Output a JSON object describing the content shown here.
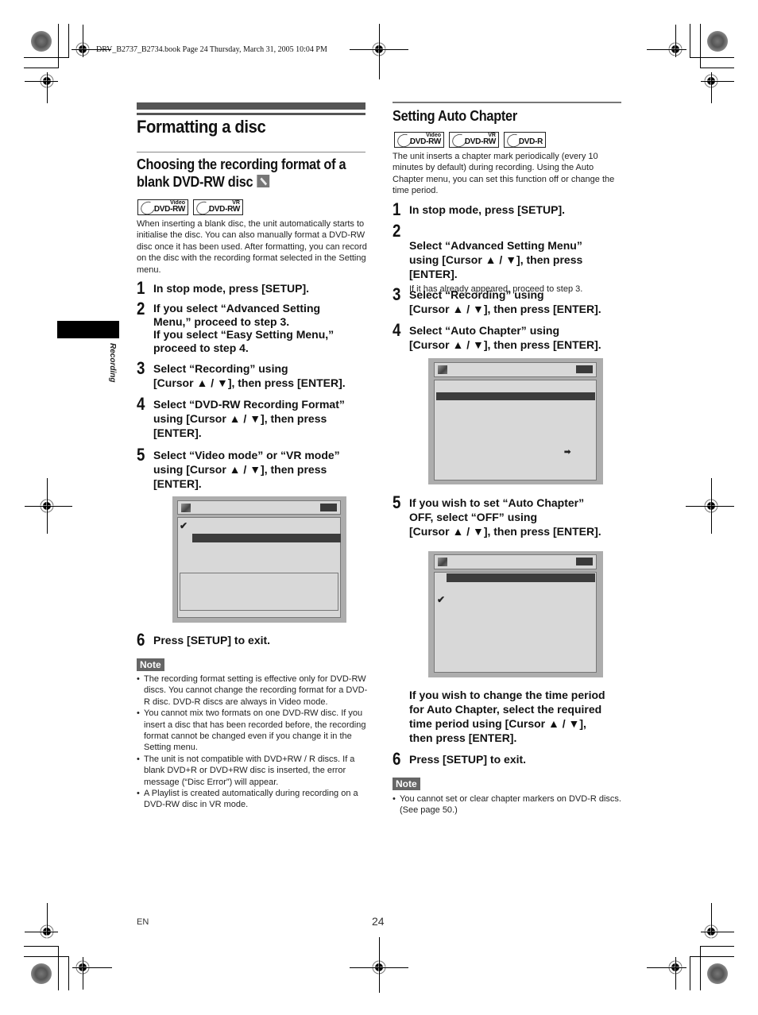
{
  "print_header": "DRV_B2737_B2734.book  Page 24  Thursday, March 31, 2005  10:04 PM",
  "side_tab": {
    "label": "Recording"
  },
  "left": {
    "page_title": "Formatting a disc",
    "section_title": "Choosing the recording format of a blank DVD-RW disc",
    "section_icon": "wrench-icon",
    "badges": [
      {
        "top": "Video",
        "main": "DVD-RW"
      },
      {
        "top": "VR",
        "main": "DVD-RW"
      }
    ],
    "intro": "When inserting a blank disc, the unit automatically starts to initialise the disc. You can also manually format a DVD-RW disc once it has been used. After formatting, you can record on the disc with the recording format selected in the Setting menu.",
    "steps": [
      {
        "num": "1",
        "text": "In stop mode, press [SETUP]."
      },
      {
        "num": "2",
        "text": "If you select “Advanced Setting\nMenu,” proceed to step 3.\nIf you select “Easy Setting Menu,”\nproceed to step 4."
      },
      {
        "num": "3",
        "text": "Select “Recording” using\n[Cursor ▲ / ▼], then press [ENTER]."
      },
      {
        "num": "4",
        "text": "Select “DVD-RW Recording Format”\nusing [Cursor ▲ / ▼], then press\n[ENTER]."
      },
      {
        "num": "5",
        "text": "Select “Video mode” or “VR mode”\nusing [Cursor ▲ / ▼], then press\n[ENTER]."
      },
      {
        "num": "6",
        "text": "Press [SETUP] to exit."
      }
    ],
    "note_label": "Note",
    "notes": [
      "The recording format setting is effective only for DVD-RW discs. You cannot change the recording format for a DVD-R disc. DVD-R discs are always in Video mode.",
      "You cannot mix two formats on one DVD-RW disc. If you insert a disc that has been recorded before, the recording format cannot be changed even if you change it in the Setting menu.",
      "The unit is not compatible with DVD+RW / R discs. If a blank DVD+R or DVD+RW disc is inserted, the error message (“Disc Error”) will appear.",
      "A Playlist is created automatically during recording on a DVD-RW disc in VR mode."
    ]
  },
  "right": {
    "section_title": "Setting Auto Chapter",
    "badges": [
      {
        "top": "Video",
        "main": "DVD-RW"
      },
      {
        "top": "VR",
        "main": "DVD-RW"
      },
      {
        "top": "",
        "main": "DVD-R"
      }
    ],
    "intro": "The unit inserts a chapter mark periodically (every 10 minutes by default) during recording. Using the Auto Chapter menu, you can set this function off or change the time period.",
    "steps": [
      {
        "num": "1",
        "text": "In stop mode, press [SETUP]."
      },
      {
        "num": "2",
        "text": "Select “Advanced Setting Menu”\nusing [Cursor ▲ / ▼], then press\n[ENTER].",
        "sub": "If it has already appeared, proceed to step 3."
      },
      {
        "num": "3",
        "text": "Select “Recording” using\n[Cursor ▲ / ▼], then press [ENTER]."
      },
      {
        "num": "4",
        "text": "Select “Auto Chapter” using\n[Cursor ▲ / ▼], then press [ENTER]."
      },
      {
        "num": "5",
        "text": "If you wish to set “Auto Chapter”\nOFF, select “OFF” using\n[Cursor ▲ / ▼], then press [ENTER]."
      },
      {
        "num": "",
        "text": "If you wish to change the time period\nfor Auto Chapter, select the required\ntime period using [Cursor ▲ / ▼],\nthen press [ENTER]."
      },
      {
        "num": "6",
        "text": "Press [SETUP] to exit."
      }
    ],
    "note_label": "Note",
    "notes": [
      "You cannot set or clear chapter markers on DVD-R discs. (See page 50.)"
    ]
  },
  "screens": {
    "check_glyph": "✔",
    "arrow_glyph": "➡"
  },
  "footer": {
    "lang": "EN",
    "page": "24"
  }
}
